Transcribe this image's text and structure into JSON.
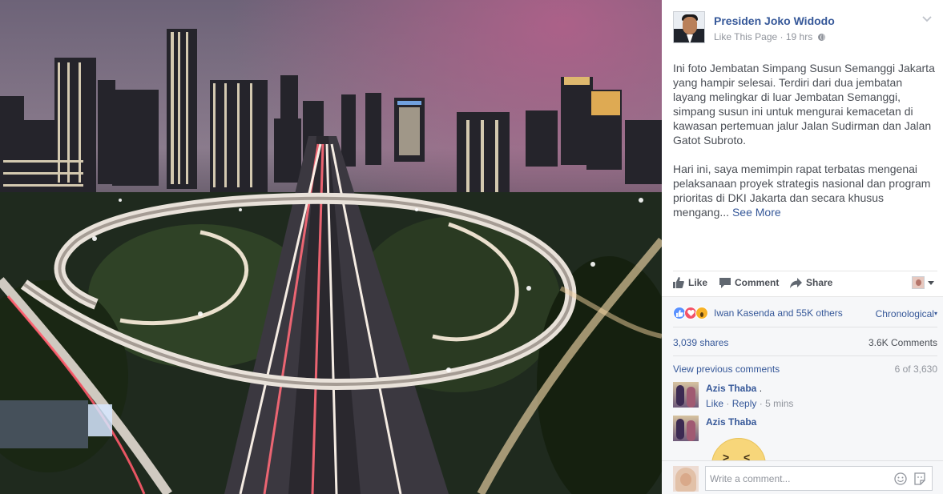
{
  "post": {
    "page_name": "Presiden Joko Widodo",
    "like_page": "Like This Page",
    "separator": "·",
    "time": "19 hrs",
    "paragraph_1": "Ini foto Jembatan Simpang Susun Semanggi Jakarta yang hampir selesai. Terdiri dari dua jembatan layang melingkar di luar Jembatan Semanggi, simpang susun ini untuk mengurai kemacetan di kawasan pertemuan jalur Jalan Sudirman dan Jalan Gatot Subroto.",
    "paragraph_2": "Hari ini, saya memimpin rapat terbatas mengenai pelaksanaan proyek strategis nasional dan program prioritas di DKI Jakarta dan secara khusus mengang...",
    "see_more": "See More"
  },
  "actions": {
    "like": "Like",
    "comment": "Comment",
    "share": "Share"
  },
  "reactions": {
    "summary": "Iwan Kasenda and 55K others",
    "sort": "Chronological"
  },
  "counts": {
    "shares": "3,039 shares",
    "comments": "3.6K Comments"
  },
  "comments": {
    "view_previous": "View previous comments",
    "position": "6 of 3,630",
    "items": [
      {
        "name": "Azis Thaba",
        "text": ".",
        "like": "Like",
        "reply": "Reply",
        "separator": "·",
        "time": "5 mins"
      },
      {
        "name": "Azis Thaba"
      }
    ],
    "placeholder": "Write a comment..."
  },
  "icons": {
    "page_avatar": "page-profile-photo",
    "menu": "chevron-down-icon",
    "privacy": "globe-icon",
    "like": "thumbs-up-icon",
    "comment": "speech-bubble-icon",
    "share": "share-arrow-icon",
    "emoji": "smiley-icon",
    "sticker": "sticker-icon"
  },
  "colors": {
    "link": "#365899",
    "text": "#4b4f56",
    "muted": "#90949c",
    "panel_bg": "#ffffff",
    "comments_bg": "#f6f7f9",
    "like_reaction": "#5890ff",
    "love_reaction": "#f25268",
    "wow_reaction": "#f7b125"
  }
}
